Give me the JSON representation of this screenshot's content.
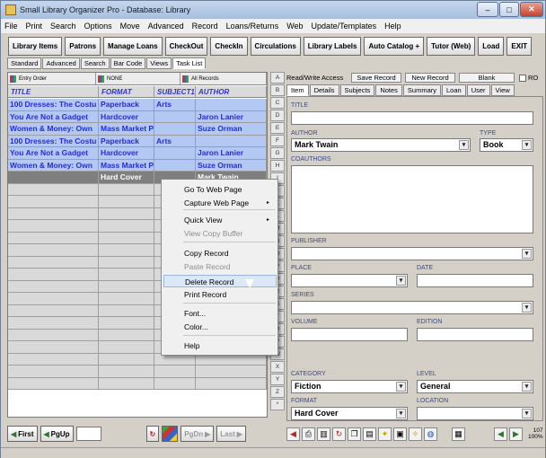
{
  "window": {
    "title": "Small Library Organizer Pro - Database: Library",
    "minimize": "–",
    "maximize": "□",
    "close": "✕"
  },
  "menu": [
    "File",
    "Print",
    "Search",
    "Options",
    "Move",
    "Advanced",
    "Record",
    "Loans/Returns",
    "Web",
    "Update/Templates",
    "Help"
  ],
  "toolbar": [
    "Library Items",
    "Patrons",
    "Manage Loans",
    "CheckOut",
    "CheckIn",
    "Circulations",
    "Library Labels",
    "Auto Catalog +",
    "Tutor (Web)",
    "Load",
    "EXIT"
  ],
  "view_tabs": [
    "Standard",
    "Advanced",
    "Search",
    "Bar Code",
    "Views",
    "Task List"
  ],
  "sort": {
    "entry_order": "Entry Order",
    "none": "NONE",
    "all_records": "All Records"
  },
  "columns": [
    "TITLE",
    "FORMAT",
    "SUBJECT1",
    "AUTHOR"
  ],
  "rows": [
    [
      "100 Dresses: The Costu",
      "Paperback",
      "Arts",
      ""
    ],
    [
      "You Are Not a Gadget",
      "Hardcover",
      "",
      "Jaron Lanier"
    ],
    [
      "Women & Money: Own",
      "Mass Market P",
      "",
      "Suze Orman"
    ],
    [
      "100 Dresses: The Costu",
      "Paperback",
      "Arts",
      ""
    ],
    [
      "You Are Not a Gadget",
      "Hardcover",
      "",
      "Jaron Lanier"
    ],
    [
      "Women & Money: Own",
      "Mass Market P",
      "",
      "Suze Orman"
    ],
    [
      "",
      "Hard Cover",
      "",
      "Mark Twain"
    ]
  ],
  "letters": [
    "A",
    "B",
    "C",
    "D",
    "E",
    "F",
    "G",
    "H",
    "I",
    "J",
    "K",
    "L",
    "M",
    "N",
    "O",
    "P",
    "Q",
    "R",
    "S",
    "T",
    "U",
    "V",
    "W",
    "X",
    "Y",
    "Z",
    "*"
  ],
  "right_top": {
    "read_write": "Read/Write Access",
    "save": "Save Record",
    "new": "New Record",
    "blank": "Blank",
    "ro": "RO"
  },
  "right_tabs": [
    "Item",
    "Details",
    "Subjects",
    "Notes",
    "Summary",
    "Loan",
    "User",
    "View"
  ],
  "form": {
    "title": {
      "label": "TITLE",
      "value": ""
    },
    "author": {
      "label": "AUTHOR",
      "value": "Mark Twain"
    },
    "type": {
      "label": "TYPE",
      "value": "Book"
    },
    "coauthors": {
      "label": "COAUTHORS"
    },
    "publisher": {
      "label": "PUBLISHER"
    },
    "place": {
      "label": "PLACE"
    },
    "date": {
      "label": "DATE"
    },
    "series": {
      "label": "SERIES"
    },
    "volume": {
      "label": "VOLUME"
    },
    "edition": {
      "label": "EDITION"
    },
    "category": {
      "label": "CATEGORY",
      "value": "Fiction"
    },
    "level": {
      "label": "LEVEL",
      "value": "General"
    },
    "format": {
      "label": "FORMAT",
      "value": "Hard Cover"
    },
    "location": {
      "label": "LOCATION"
    }
  },
  "nav": {
    "first": "First",
    "pgup": "PgUp",
    "pgdn": "PgDn",
    "last": "Last"
  },
  "status": {
    "count": "107",
    "zoom": "100%"
  },
  "context_menu": [
    {
      "label": "Go To Web Page",
      "submenu": false,
      "disabled": false
    },
    {
      "label": "Capture Web Page",
      "submenu": true,
      "disabled": false
    },
    {
      "label": "Quick View",
      "submenu": true,
      "disabled": false
    },
    {
      "label": "View Copy Buffer",
      "submenu": false,
      "disabled": true
    },
    {
      "label": "Copy Record",
      "submenu": false,
      "disabled": false
    },
    {
      "label": "Paste Record",
      "submenu": false,
      "disabled": true
    },
    {
      "label": "Delete Record",
      "submenu": false,
      "disabled": false
    },
    {
      "label": "Print Record",
      "submenu": false,
      "disabled": false
    },
    {
      "label": "Font...",
      "submenu": false,
      "disabled": false
    },
    {
      "label": "Color...",
      "submenu": false,
      "disabled": false
    },
    {
      "label": "Help",
      "submenu": false,
      "disabled": false
    }
  ],
  "submenu_arrow": "▸",
  "dropdown_arrow": "▾",
  "colors": {
    "grid_text": "#2a2ad8",
    "row_highlight": "#b3c8f2",
    "selected_row": "#7f7f7f"
  }
}
